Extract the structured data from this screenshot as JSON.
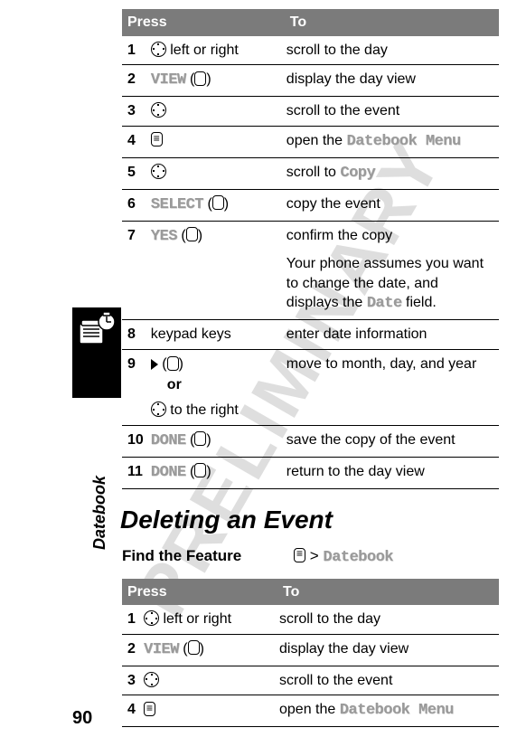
{
  "page_number": "90",
  "sidebar_label": "Datebook",
  "watermark": "PRELIMINARY",
  "table1": {
    "head_press": "Press",
    "head_to": "To",
    "rows": {
      "r1": {
        "num": "1",
        "press_suffix": " left or right",
        "to": "scroll to the day"
      },
      "r2": {
        "num": "2",
        "ui": "VIEW",
        "to": "display the day view"
      },
      "r3": {
        "num": "3",
        "to": "scroll to the event"
      },
      "r4": {
        "num": "4",
        "to_prefix": "open the ",
        "to_ui": "Datebook Menu"
      },
      "r5": {
        "num": "5",
        "to_prefix": "scroll to ",
        "to_ui": "Copy"
      },
      "r6": {
        "num": "6",
        "ui": "SELECT",
        "to": "copy the event"
      },
      "r7": {
        "num": "7",
        "ui": "YES",
        "to": "confirm the copy",
        "to2_prefix": "Your phone assumes you want to change the date, and displays the ",
        "to2_ui": "Date",
        "to2_suffix": " field."
      },
      "r8": {
        "num": "8",
        "press": "keypad keys",
        "to": "enter date information"
      },
      "r9": {
        "num": "9",
        "or": "or",
        "press2": " to the right",
        "to": "move to month, day, and year"
      },
      "r10": {
        "num": "10",
        "ui": "DONE",
        "to": "save the copy of the event"
      },
      "r11": {
        "num": "11",
        "ui": "DONE",
        "to": "return to the day view"
      }
    }
  },
  "heading": "Deleting an Event",
  "feature": {
    "label": "Find the Feature",
    "sep": " > ",
    "value_ui": "Datebook"
  },
  "table2": {
    "head_press": "Press",
    "head_to": "To",
    "rows": {
      "r1": {
        "num": "1",
        "press_suffix": " left or right",
        "to": "scroll to the day"
      },
      "r2": {
        "num": "2",
        "ui": "VIEW",
        "to": "display the day view"
      },
      "r3": {
        "num": "3",
        "to": "scroll to the event"
      },
      "r4": {
        "num": "4",
        "to_prefix": "open the ",
        "to_ui": "Datebook Menu"
      }
    }
  }
}
